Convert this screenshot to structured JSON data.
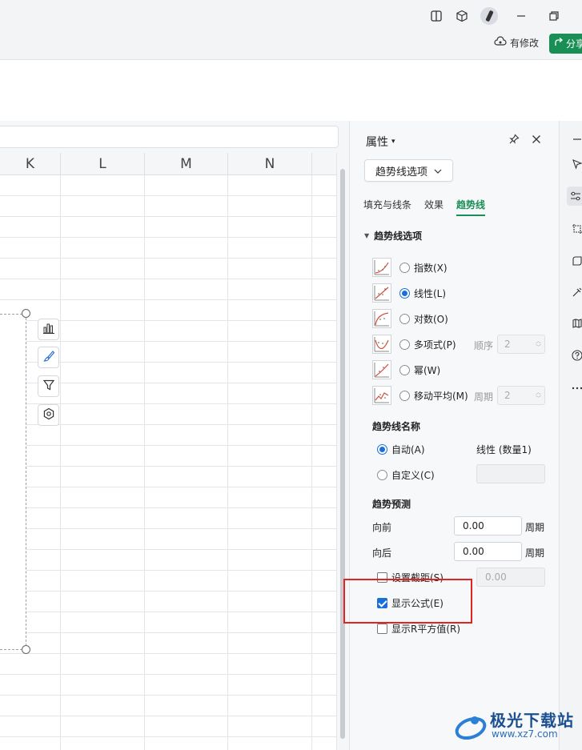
{
  "titlebar": {
    "save_status": "有修改",
    "share_label": "分享"
  },
  "columns": [
    "K",
    "L",
    "M",
    "N"
  ],
  "pane": {
    "title": "属性",
    "dropdown_label": "趋势线选项",
    "tabs": [
      "填充与线条",
      "效果",
      "趋势线"
    ],
    "active_tab": "趋势线",
    "section_title": "趋势线选项",
    "trend_types": [
      {
        "label": "指数(X)",
        "selected": false
      },
      {
        "label": "线性(L)",
        "selected": true
      },
      {
        "label": "对数(O)",
        "selected": false
      },
      {
        "label": "多项式(P)",
        "selected": false,
        "sub_label": "顺序",
        "sub_value": "2"
      },
      {
        "label": "幂(W)",
        "selected": false
      },
      {
        "label": "移动平均(M)",
        "selected": false,
        "sub_label": "周期",
        "sub_value": "2"
      }
    ],
    "name_group": {
      "title": "趋势线名称",
      "auto_label": "自动(A)",
      "auto_value": "线性 (数量1)",
      "custom_label": "自定义(C)",
      "custom_value": ""
    },
    "forecast_group": {
      "title": "趋势预测",
      "forward_label": "向前",
      "forward_value": "0.00",
      "forward_unit": "周期",
      "backward_label": "向后",
      "backward_value": "0.00",
      "backward_unit": "周期",
      "intercept_label": "设置截距(S)",
      "intercept_value": "0.00",
      "intercept_checked": false,
      "show_equation_label": "显示公式(E)",
      "show_equation_checked": true,
      "show_r2_label": "显示R平方值(R)",
      "show_r2_checked": false
    }
  },
  "watermark": {
    "title": "极光下载站",
    "url": "www.xz7.com"
  },
  "colors": {
    "accent": "#1a8f55",
    "checkbox_blue": "#1a6fd8",
    "highlight_red": "#e52222"
  }
}
